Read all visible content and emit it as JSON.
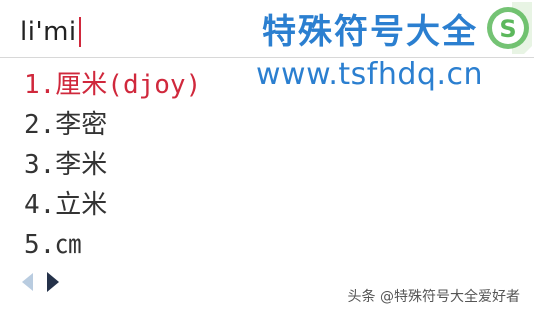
{
  "composition": {
    "text": "li'mi"
  },
  "candidates": [
    {
      "label": "1.厘米(djoy)"
    },
    {
      "label": "2.李密"
    },
    {
      "label": "3.李米"
    },
    {
      "label": "4.立米"
    },
    {
      "label": "5.㎝"
    }
  ],
  "watermark": {
    "title": "特殊符号大全",
    "url": "www.tsfhdq.cn"
  },
  "logo": {
    "letter": "S"
  },
  "attribution": "头条 @特殊符号大全爱好者",
  "colors": {
    "selected_candidate": "#d0283c",
    "watermark_blue": "#2b7fd0",
    "logo_green": "#5cb85c"
  },
  "icons": {
    "prev": "triangle-left-icon",
    "next": "triangle-right-icon"
  }
}
